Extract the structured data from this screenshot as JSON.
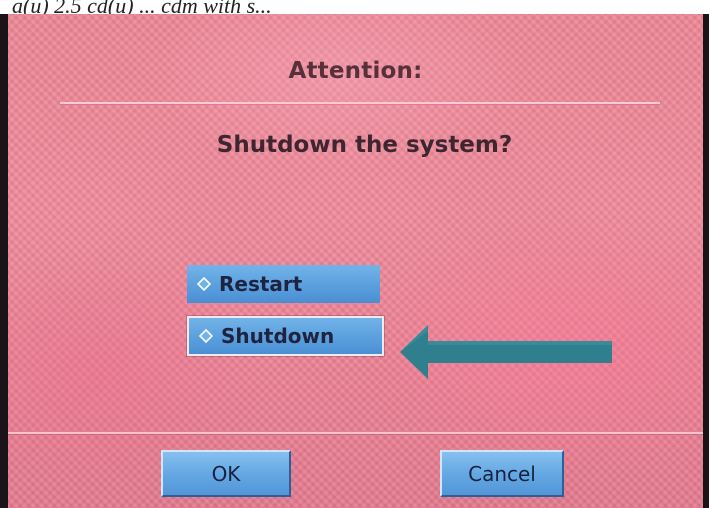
{
  "top_text": "a(u) 2.5 cd(u) ... cdm with s...",
  "dialog": {
    "title": "Attention:",
    "question": "Shutdown the system?",
    "options": [
      {
        "label": "Restart",
        "icon": "diamond-icon",
        "selected": false
      },
      {
        "label": "Shutdown",
        "icon": "diamond-icon",
        "selected": true
      }
    ],
    "arrow_icon": "arrow-left-icon",
    "buttons": {
      "ok_label": "OK",
      "cancel_label": "Cancel"
    }
  },
  "colors": {
    "background": "#f08a9b",
    "option_fill": "#5aa0de",
    "arrow": "#2f7f8f",
    "text_dark": "#3e2630"
  }
}
